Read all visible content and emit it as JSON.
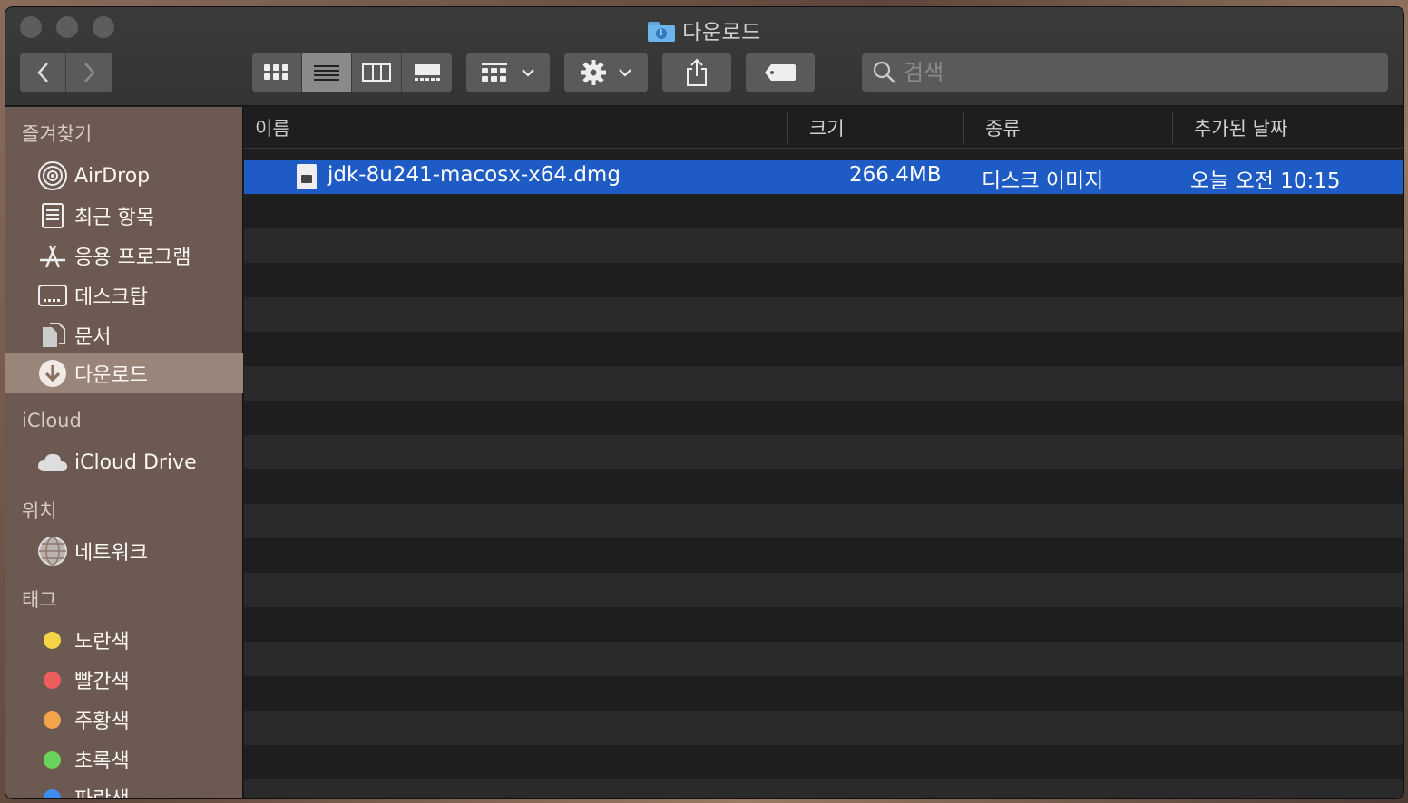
{
  "window": {
    "title": "다운로드"
  },
  "toolbar": {
    "back_icon": "chevron-left-icon",
    "forward_icon": "chevron-right-icon",
    "view_modes": [
      "icon-view",
      "list-view",
      "column-view",
      "gallery-view"
    ],
    "selected_view": "list-view",
    "search_placeholder": "검색"
  },
  "sidebar": {
    "favorites_header": "즐겨찾기",
    "favorites": [
      {
        "label": "AirDrop",
        "icon": "airdrop-icon"
      },
      {
        "label": "최근 항목",
        "icon": "recents-icon"
      },
      {
        "label": "응용 프로그램",
        "icon": "applications-icon"
      },
      {
        "label": "데스크탑",
        "icon": "desktop-icon"
      },
      {
        "label": "문서",
        "icon": "documents-icon"
      },
      {
        "label": "다운로드",
        "icon": "downloads-icon",
        "selected": true
      }
    ],
    "icloud_header": "iCloud",
    "icloud": [
      {
        "label": "iCloud Drive",
        "icon": "cloud-icon"
      }
    ],
    "locations_header": "위치",
    "locations": [
      {
        "label": "네트워크",
        "icon": "network-icon"
      }
    ],
    "tags_header": "태그",
    "tags": [
      {
        "label": "노란색",
        "color": "#f5d547"
      },
      {
        "label": "빨간색",
        "color": "#ee5d5d"
      },
      {
        "label": "주황색",
        "color": "#f3a44a"
      },
      {
        "label": "초록색",
        "color": "#6ad35b"
      },
      {
        "label": "파란색",
        "color": "#3d8ef0"
      }
    ]
  },
  "columns": {
    "name": "이름",
    "size": "크기",
    "kind": "종류",
    "date_added": "추가된 날짜"
  },
  "files": [
    {
      "name": "jdk-8u241-macosx-x64.dmg",
      "size": "266.4MB",
      "kind": "디스크 이미지",
      "date_added": "오늘 오전 10:15",
      "selected": true
    }
  ],
  "colors": {
    "selection": "#1f5bc4",
    "sidebar_selected": "#9a857a"
  }
}
